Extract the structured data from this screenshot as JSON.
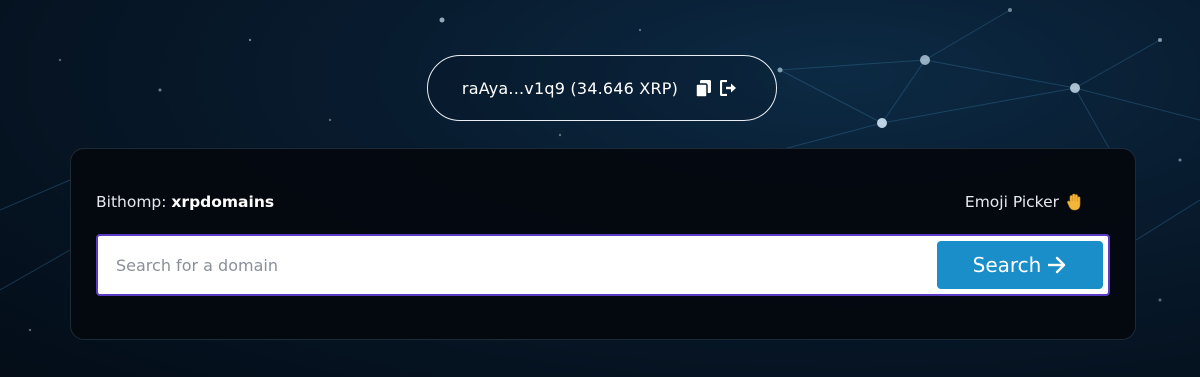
{
  "wallet": {
    "address_short": "raAya...v1q9",
    "balance": "(34.646 XRP)",
    "copy_icon": "copy-icon",
    "logout_icon": "sign-out-icon"
  },
  "panel": {
    "brand_prefix": "Bithomp: ",
    "brand_name": "xrpdomains",
    "emoji_picker_label": "Emoji Picker",
    "emoji_icon": "waving-hand-icon"
  },
  "search": {
    "placeholder": "Search for a domain",
    "value": "",
    "button_label": "Search",
    "button_icon": "arrow-right-icon"
  },
  "colors": {
    "accent": "#1a8ec9",
    "input_border": "#5b3cc4",
    "background": "#051220"
  }
}
